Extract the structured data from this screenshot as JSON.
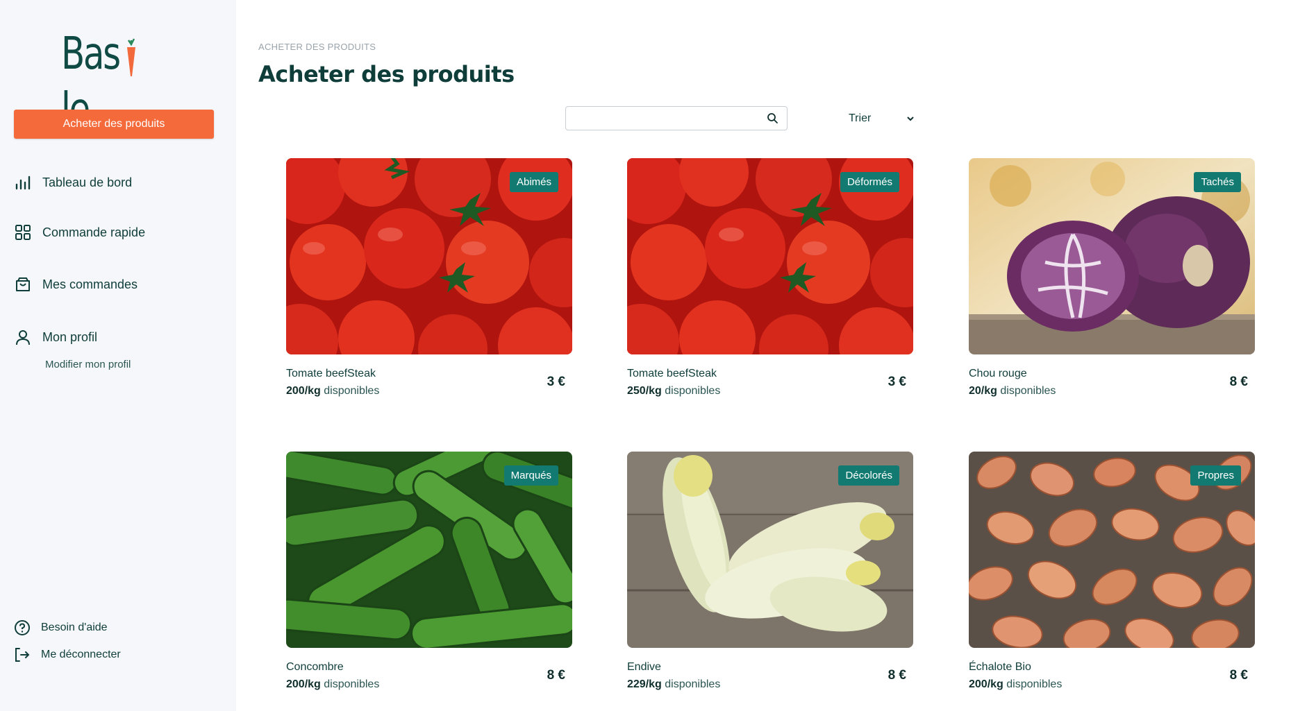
{
  "app": {
    "logo_text_1": "Bas",
    "logo_text_2": "le",
    "logo_dot": "."
  },
  "sidebar": {
    "cta_label": "Acheter des produits",
    "items": [
      {
        "label": "Tableau de bord",
        "icon": "bar-chart-icon"
      },
      {
        "label": "Commande rapide",
        "icon": "grid-icon"
      },
      {
        "label": "Mes commandes",
        "icon": "bag-icon"
      },
      {
        "label": "Mon profil",
        "icon": "user-icon"
      }
    ],
    "sub_item": "Modifier mon profil",
    "footer": [
      {
        "label": "Besoin d'aide",
        "icon": "help-icon"
      },
      {
        "label": "Me déconnecter",
        "icon": "logout-icon"
      }
    ]
  },
  "main": {
    "breadcrumb": "ACHETER DES PRODUITS",
    "title": "Acheter des produits",
    "search": {
      "value": "",
      "placeholder": ""
    },
    "sort_label": "Trier",
    "stock_suffix": "disponibles",
    "products": [
      {
        "name": "Tomate beefSteak",
        "qty": "200/kg",
        "price": "3 €",
        "badge": "Abimés"
      },
      {
        "name": "Tomate beefSteak",
        "qty": "250/kg",
        "price": "3 €",
        "badge": "Déformés"
      },
      {
        "name": "Chou rouge",
        "qty": "20/kg",
        "price": "8 €",
        "badge": "Tachés"
      },
      {
        "name": "Concombre",
        "qty": "200/kg",
        "price": "8 €",
        "badge": "Marqués"
      },
      {
        "name": "Endive",
        "qty": "229/kg",
        "price": "8 €",
        "badge": "Décolorés"
      },
      {
        "name": "Échalote Bio",
        "qty": "200/kg",
        "price": "8 €",
        "badge": "Propres"
      }
    ]
  },
  "colors": {
    "brand_dark": "#0f3d3a",
    "accent": "#f56a3b",
    "badge": "#137a72",
    "sidebar_bg": "#f5f7fa"
  }
}
